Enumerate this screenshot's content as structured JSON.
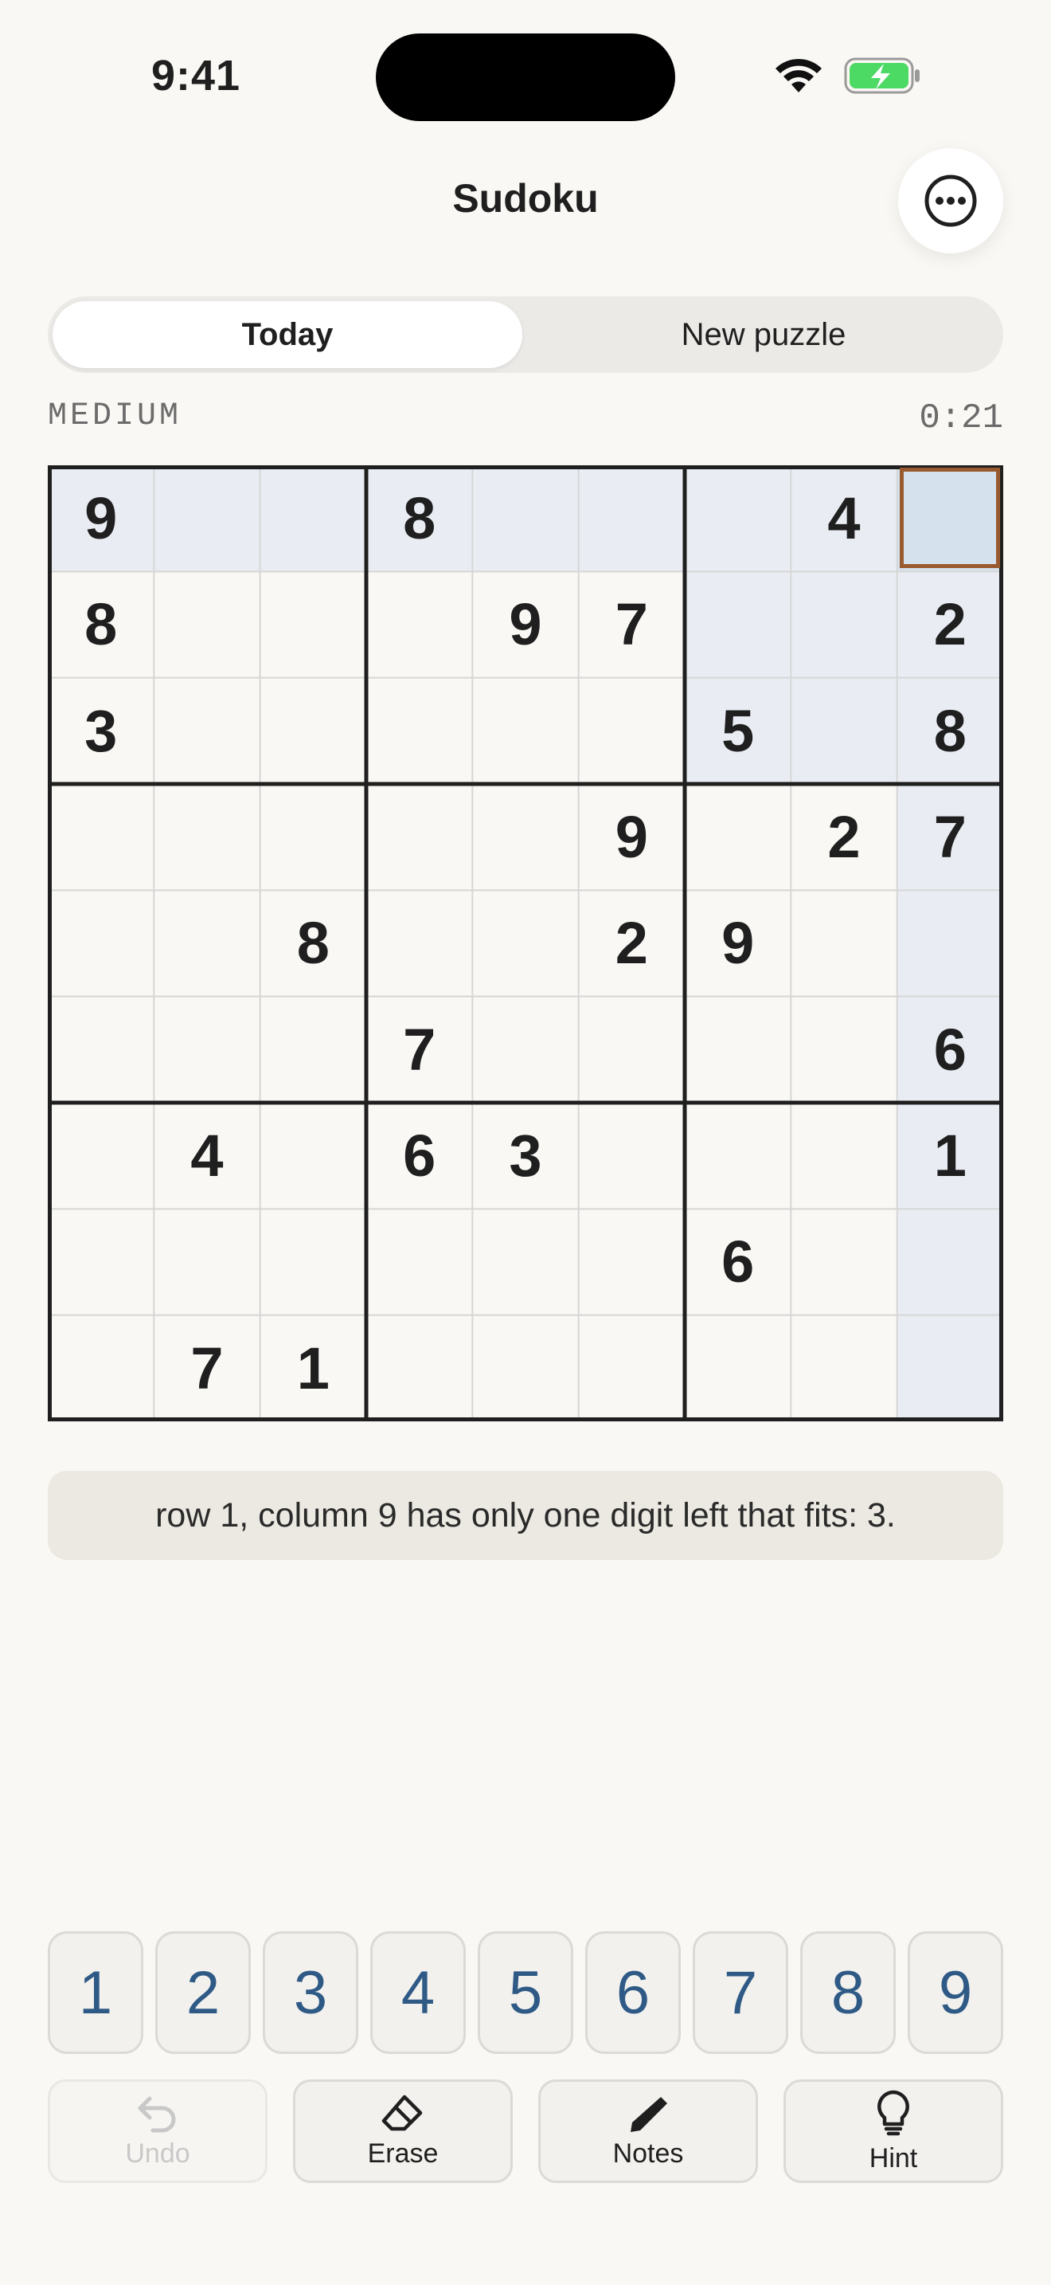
{
  "status": {
    "time": "9:41"
  },
  "header": {
    "title": "Sudoku",
    "more_icon": "ellipsis-circle-icon"
  },
  "tabs": [
    {
      "label": "Today",
      "active": true
    },
    {
      "label": "New puzzle",
      "active": false
    }
  ],
  "difficulty": "MEDIUM",
  "timer": "0:21",
  "board": {
    "cells": [
      [
        "9",
        "",
        "",
        "8",
        "",
        "",
        "",
        "4",
        ""
      ],
      [
        "8",
        "",
        "",
        "",
        "9",
        "7",
        "",
        "",
        "2"
      ],
      [
        "3",
        "",
        "",
        "",
        "",
        "",
        "5",
        "",
        "8"
      ],
      [
        "",
        "",
        "",
        "",
        "",
        "9",
        "",
        "2",
        "7"
      ],
      [
        "",
        "",
        "8",
        "",
        "",
        "2",
        "9",
        "",
        ""
      ],
      [
        "",
        "",
        "",
        "7",
        "",
        "",
        "",
        "",
        "6"
      ],
      [
        "",
        "4",
        "",
        "6",
        "3",
        "",
        "",
        "",
        "1"
      ],
      [
        "",
        "",
        "",
        "",
        "",
        "",
        "6",
        "",
        ""
      ],
      [
        "",
        "7",
        "1",
        "",
        "",
        "",
        "",
        "",
        ""
      ]
    ],
    "selected": {
      "row": 1,
      "col": 9
    }
  },
  "hint_text": "row 1, column 9 has only one digit left that fits: 3.",
  "numpad": [
    "1",
    "2",
    "3",
    "4",
    "5",
    "6",
    "7",
    "8",
    "9"
  ],
  "actions": {
    "undo": "Undo",
    "erase": "Erase",
    "notes": "Notes",
    "hint": "Hint"
  },
  "colors": {
    "accent_digit": "#2F5A86",
    "selected_cell": "#D5E2EE",
    "peer_highlight": "#E9EDF3",
    "selection_border": "#9A5A2F",
    "background": "#FAF8F4"
  }
}
